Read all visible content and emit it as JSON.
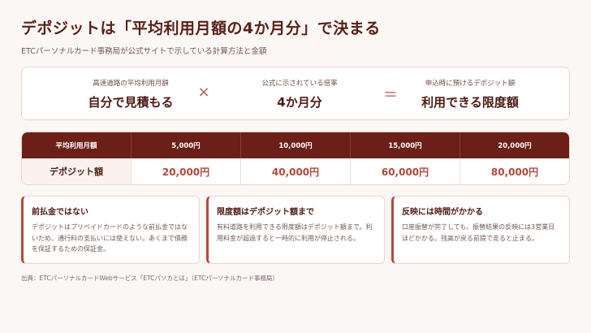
{
  "title": "デポジットは「平均利用月額の4か月分」で決まる",
  "subtitle": "ETCパーソナルカード事務局が公式サイトで示している計算方法と金額",
  "formula": {
    "items": [
      {
        "caption": "高速道路の平均利用月額",
        "value": "自分で見積もる"
      },
      {
        "caption": "公式に示されている倍率",
        "value": "4か月分"
      },
      {
        "caption": "申込時に預けるデポジット額",
        "value": "利用できる限度額"
      }
    ],
    "ops": [
      "×",
      "＝"
    ]
  },
  "table": {
    "headers": [
      "平均利用月額",
      "5,000円",
      "10,000円",
      "15,000円",
      "20,000円"
    ],
    "row_label": "デポジット額",
    "values": [
      "20,000円",
      "40,000円",
      "60,000円",
      "80,000円"
    ]
  },
  "cards": [
    {
      "heading": "前払金ではない",
      "body": "デポジットはプリペイドカードのような前払金ではないため、通行料の支払いには使えない。あくまで債務を保証するための保証金。"
    },
    {
      "heading": "限度額はデポジット額まで",
      "body": "有料道路を利用できる限度額はデポジット額まで。利用料金が超過すると一時的に利用が停止される。"
    },
    {
      "heading": "反映には時間がかかる",
      "body": "口座振替が完了しても、振替結果の反映には3営業日ほどかかる。残高が戻る前提で走ると止まる。"
    }
  ],
  "source": "出典：ETCパーソナルカードWebサービス「ETCパソカとは」（ETCパーソナルカード事務局）"
}
